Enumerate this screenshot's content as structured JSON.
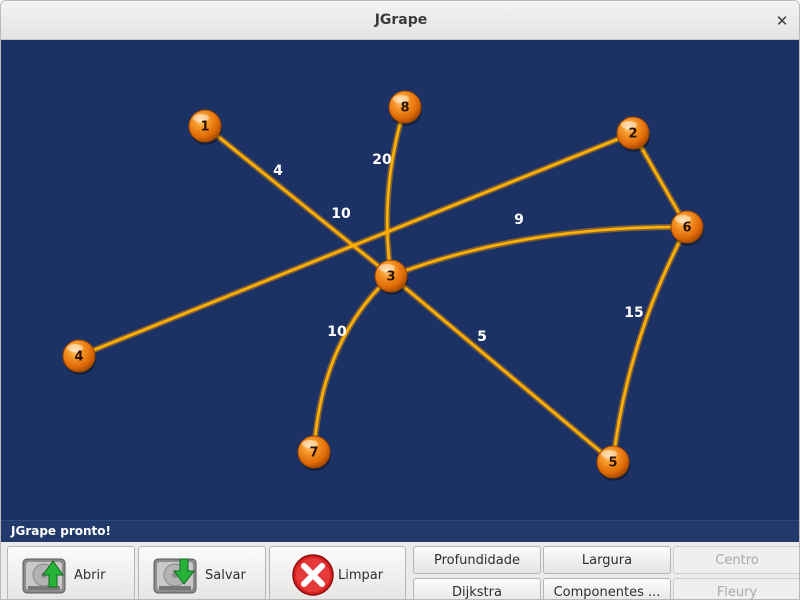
{
  "window": {
    "title": "JGrape"
  },
  "graph": {
    "nodes": [
      {
        "id": "1",
        "label": "1"
      },
      {
        "id": "2",
        "label": "2"
      },
      {
        "id": "3",
        "label": "3"
      },
      {
        "id": "4",
        "label": "4"
      },
      {
        "id": "5",
        "label": "5"
      },
      {
        "id": "6",
        "label": "6"
      },
      {
        "id": "7",
        "label": "7"
      },
      {
        "id": "8",
        "label": "8"
      }
    ],
    "edges": [
      {
        "from": "1",
        "to": "3",
        "weight": "4"
      },
      {
        "from": "8",
        "to": "3",
        "weight": "20"
      },
      {
        "from": "4",
        "to": "2",
        "weight": "10"
      },
      {
        "from": "3",
        "to": "6",
        "weight": "9"
      },
      {
        "from": "2",
        "to": "6",
        "weight": ""
      },
      {
        "from": "3",
        "to": "7",
        "weight": "10"
      },
      {
        "from": "3",
        "to": "5",
        "weight": "5"
      },
      {
        "from": "6",
        "to": "5",
        "weight": "15"
      }
    ],
    "colors": {
      "background": "#1d3264",
      "edge": "#ffb300",
      "node": "#f07c10",
      "label": "#ffffff"
    }
  },
  "status": {
    "text": "JGrape pronto!"
  },
  "toolbar": {
    "open_label": "Abrir",
    "save_label": "Salvar",
    "clear_label": "Limpar",
    "depth_label": "Profundidade",
    "breadth_label": "Largura",
    "center_label": "Centro",
    "dijkstra_label": "Dijkstra",
    "components_label": "Componentes ...",
    "fleury_label": "Fleury"
  }
}
